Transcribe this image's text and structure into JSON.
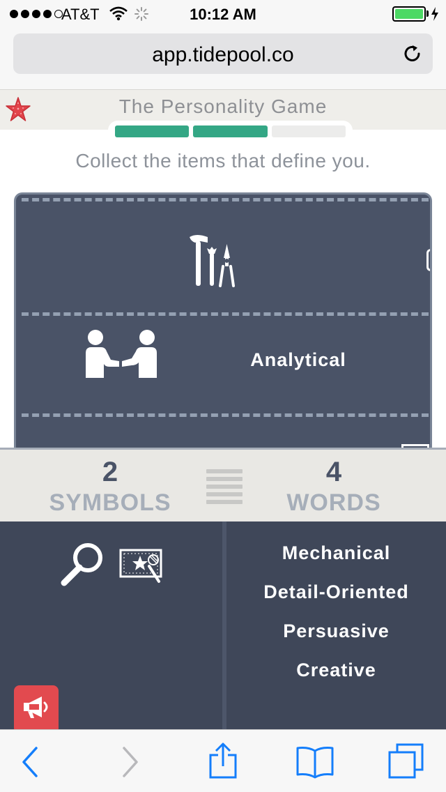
{
  "status_bar": {
    "carrier": "AT&T",
    "time": "10:12 AM",
    "signal_bars_filled": 4,
    "signal_bars_total": 5,
    "battery_level": 1.0,
    "icons": [
      "wifi-icon",
      "loading-spinner-icon",
      "battery-icon",
      "charging-bolt-icon"
    ]
  },
  "browser": {
    "url": "app.tidepool.co",
    "reload_icon": "reload-icon",
    "toolbar_icons": [
      "back-icon",
      "forward-icon",
      "share-icon",
      "bookmarks-icon",
      "tabs-icon"
    ]
  },
  "game": {
    "title": "The Personality Game",
    "logo_icon": "starfish-icon",
    "progress": {
      "completed_steps": 2,
      "total_steps": 3
    },
    "instructions": "Collect the items that define you."
  },
  "board": {
    "items": [
      {
        "type": "symbol",
        "icon": "tools-icon"
      },
      {
        "type": "symbol",
        "icon": "handshake-icon"
      },
      {
        "type": "word",
        "label": "Analytical"
      }
    ]
  },
  "counters": {
    "symbols": {
      "count": "2",
      "label": "SYMBOLS"
    },
    "words": {
      "count": "4",
      "label": "WORDS"
    },
    "handle_icon": "drag-handle-icon"
  },
  "collected": {
    "symbols": [
      "magnifier-icon",
      "star-board-icon"
    ],
    "words": [
      "Mechanical",
      "Detail-Oriented",
      "Persuasive",
      "Creative"
    ]
  },
  "feedback_button": {
    "icon": "megaphone-icon"
  },
  "colors": {
    "progress_done": "#34a785",
    "board_bg": "#4a5367",
    "panel_bg": "#3f4759",
    "accent_red": "#e24a4f",
    "ios_blue": "#147efb",
    "battery": "#4cd964"
  }
}
